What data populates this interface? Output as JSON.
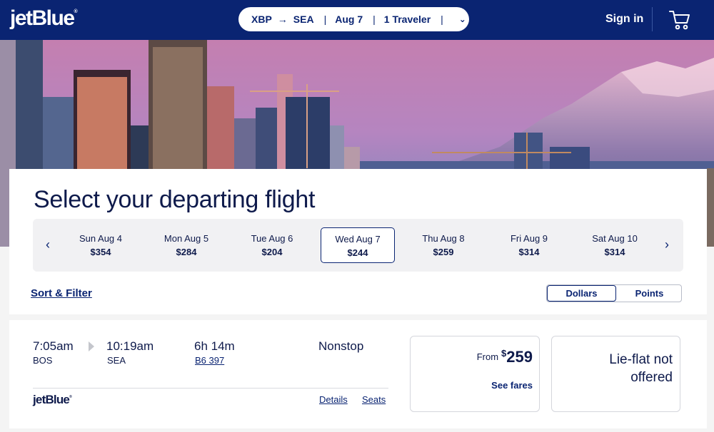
{
  "header": {
    "logo": "jetBlue",
    "trip": {
      "origin": "XBP",
      "destination": "SEA",
      "date": "Aug 7",
      "travelers": "1 Traveler"
    },
    "signin_label": "Sign in",
    "cart_icon": "cart-icon"
  },
  "main": {
    "title": "Select your departing flight",
    "dates": [
      {
        "day": "Sun Aug 4",
        "price": "$354"
      },
      {
        "day": "Mon Aug 5",
        "price": "$284"
      },
      {
        "day": "Tue Aug 6",
        "price": "$204"
      },
      {
        "day": "Wed Aug 7",
        "price": "$244"
      },
      {
        "day": "Thu Aug 8",
        "price": "$259"
      },
      {
        "day": "Fri Aug 9",
        "price": "$314"
      },
      {
        "day": "Sat Aug 10",
        "price": "$314"
      }
    ],
    "selected_date_index": 3,
    "sort_filter_label": "Sort & Filter",
    "currency_toggle": {
      "dollars": "Dollars",
      "points": "Points",
      "selected": "Dollars"
    }
  },
  "flight": {
    "depart_time": "7:05am",
    "depart_airport": "BOS",
    "arrive_time": "10:19am",
    "arrive_airport": "SEA",
    "duration": "6h 14m",
    "flight_number": "B6 397",
    "stops": "Nonstop",
    "airline": "jetBlue",
    "details_label": "Details",
    "seats_label": "Seats",
    "fare": {
      "from_label": "From",
      "currency": "$",
      "amount": "259",
      "see_fares": "See fares"
    },
    "lie_flat": "Lie-flat not offered"
  },
  "colors": {
    "brand_navy": "#0a2472",
    "text": "#0e1a4b"
  }
}
